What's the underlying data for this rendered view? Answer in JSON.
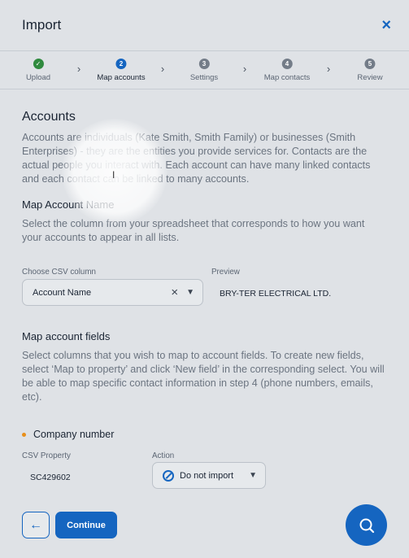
{
  "header": {
    "title": "Import",
    "close_icon": "×"
  },
  "stepper": {
    "steps": [
      {
        "number": "✓",
        "label": "Upload",
        "state": "done"
      },
      {
        "number": "2",
        "label": "Map accounts",
        "state": "active"
      },
      {
        "number": "3",
        "label": "Settings",
        "state": "pending"
      },
      {
        "number": "4",
        "label": "Map contacts",
        "state": "pending"
      },
      {
        "number": "5",
        "label": "Review",
        "state": "pending"
      }
    ],
    "separator": "›"
  },
  "accounts": {
    "heading": "Accounts",
    "description": "Accounts are individuals (Kate Smith, Smith Family) or businesses (Smith Enterprises) - they are the entities you provide services for. Contacts are the actual people you interact with. Each account can have many linked contacts and each contact can be linked to many accounts."
  },
  "map_name": {
    "heading": "Map Account Name",
    "description": "Select the column from your spreadsheet that corresponds to how you want your accounts to appear in all lists.",
    "csv_label": "Choose CSV column",
    "csv_value": "Account Name",
    "preview_label": "Preview",
    "preview_value": "BRY-TER ELECTRICAL LTD."
  },
  "map_fields": {
    "heading": "Map account fields",
    "description": "Select columns that you wish to map to account fields. To create new fields, select ‘Map to property’ and click ‘New field’ in the corresponding select. You will be able to map specific contact information in step 4 (phone numbers, emails, etc).",
    "field_name": "Company number",
    "csv_property_label": "CSV Property",
    "csv_property_value": "SC429602",
    "action_label": "Action",
    "action_value": "Do not import"
  },
  "footer": {
    "back_icon": "←",
    "continue_label": "Continue"
  },
  "colors": {
    "primary": "#1565c0",
    "done": "#2f8a3e",
    "required_dot": "#e88f1a"
  }
}
